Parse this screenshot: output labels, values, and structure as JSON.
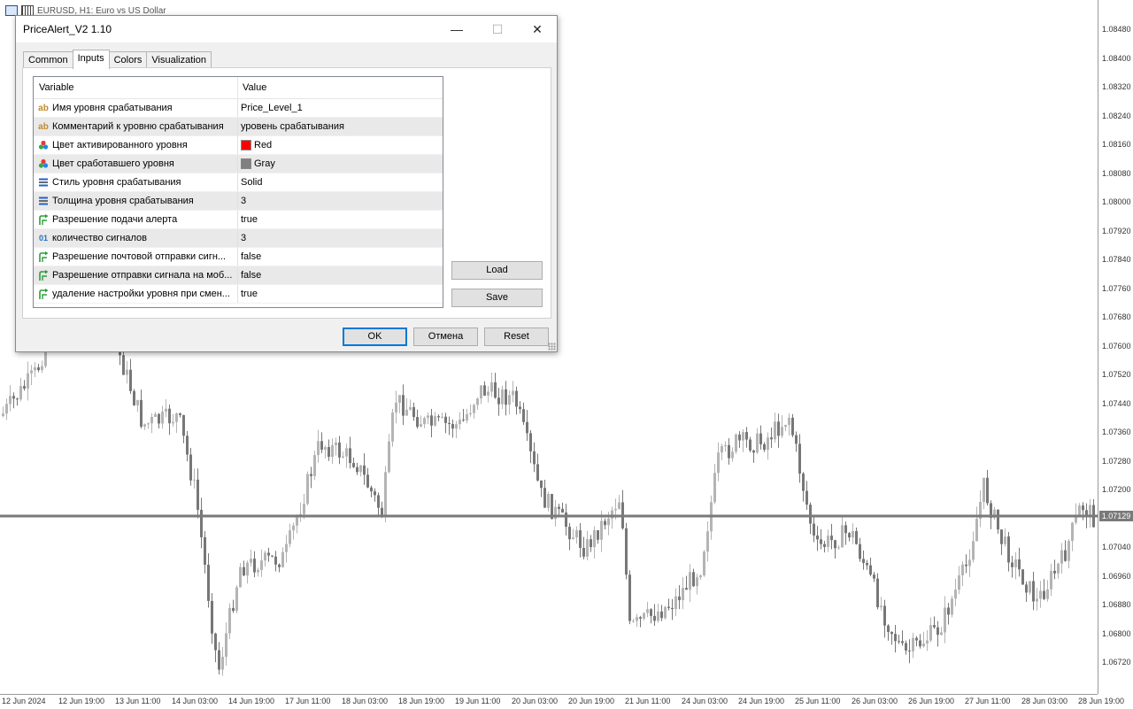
{
  "chart": {
    "header_title": "EURUSD, H1:  Euro vs US Dollar",
    "current_price": "1.07129",
    "price_labels": [
      "1.08480",
      "1.08400",
      "1.08320",
      "1.08240",
      "1.08160",
      "1.08080",
      "1.08000",
      "1.07920",
      "1.07840",
      "1.07760",
      "1.07680",
      "1.07600",
      "1.07520",
      "1.07440",
      "1.07360",
      "1.07280",
      "1.07200",
      "1.07040",
      "1.06960",
      "1.06880",
      "1.06800",
      "1.06720"
    ],
    "time_labels": [
      "12 Jun 2024",
      "12 Jun 19:00",
      "13 Jun 11:00",
      "14 Jun 03:00",
      "14 Jun 19:00",
      "17 Jun 11:00",
      "18 Jun 03:00",
      "18 Jun 19:00",
      "19 Jun 11:00",
      "20 Jun 03:00",
      "20 Jun 19:00",
      "21 Jun 11:00",
      "24 Jun 03:00",
      "24 Jun 19:00",
      "25 Jun 11:00",
      "26 Jun 03:00",
      "26 Jun 19:00",
      "27 Jun 11:00",
      "28 Jun 03:00",
      "28 Jun 19:00"
    ],
    "colors": {
      "bull": "#b4b4b4",
      "bear": "#777777",
      "price_line": "#7a7a7a"
    }
  },
  "dialog": {
    "title": "PriceAlert_V2 1.10",
    "minimize_glyph": "—",
    "maximize_glyph": "☐",
    "close_glyph": "✕",
    "tabs": [
      {
        "label": "Common"
      },
      {
        "label": "Inputs"
      },
      {
        "label": "Colors"
      },
      {
        "label": "Visualization"
      }
    ],
    "columns": {
      "variable": "Variable",
      "value": "Value"
    },
    "rows": [
      {
        "icon": "ab",
        "variable": "Имя уровня срабатывания",
        "value": "Price_Level_1"
      },
      {
        "icon": "ab",
        "variable": "Комментарий к уровню срабатывания",
        "value": "уровень срабатывания"
      },
      {
        "icon": "color",
        "variable": "Цвет активированного уровня",
        "value": "Red",
        "swatch": "#ff0000"
      },
      {
        "icon": "color",
        "variable": "Цвет сработавшего уровня",
        "value": "Gray",
        "swatch": "#808080"
      },
      {
        "icon": "style",
        "variable": "Стиль уровня срабатывания",
        "value": "Solid"
      },
      {
        "icon": "style",
        "variable": "Толщина уровня срабатывания",
        "value": "3"
      },
      {
        "icon": "bool",
        "variable": "Разрешение подачи алерта",
        "value": "true"
      },
      {
        "icon": "01",
        "variable": "количество сигналов",
        "value": "3"
      },
      {
        "icon": "bool",
        "variable": "Разрешение почтовой отправки сигн...",
        "value": "false"
      },
      {
        "icon": "bool",
        "variable": "Разрешение отправки сигнала на моб...",
        "value": "false"
      },
      {
        "icon": "bool",
        "variable": "удаление настройки уровня при смен...",
        "value": "true"
      }
    ],
    "buttons": {
      "load": "Load",
      "save": "Save",
      "ok": "OK",
      "cancel": "Отмена",
      "reset": "Reset"
    }
  }
}
